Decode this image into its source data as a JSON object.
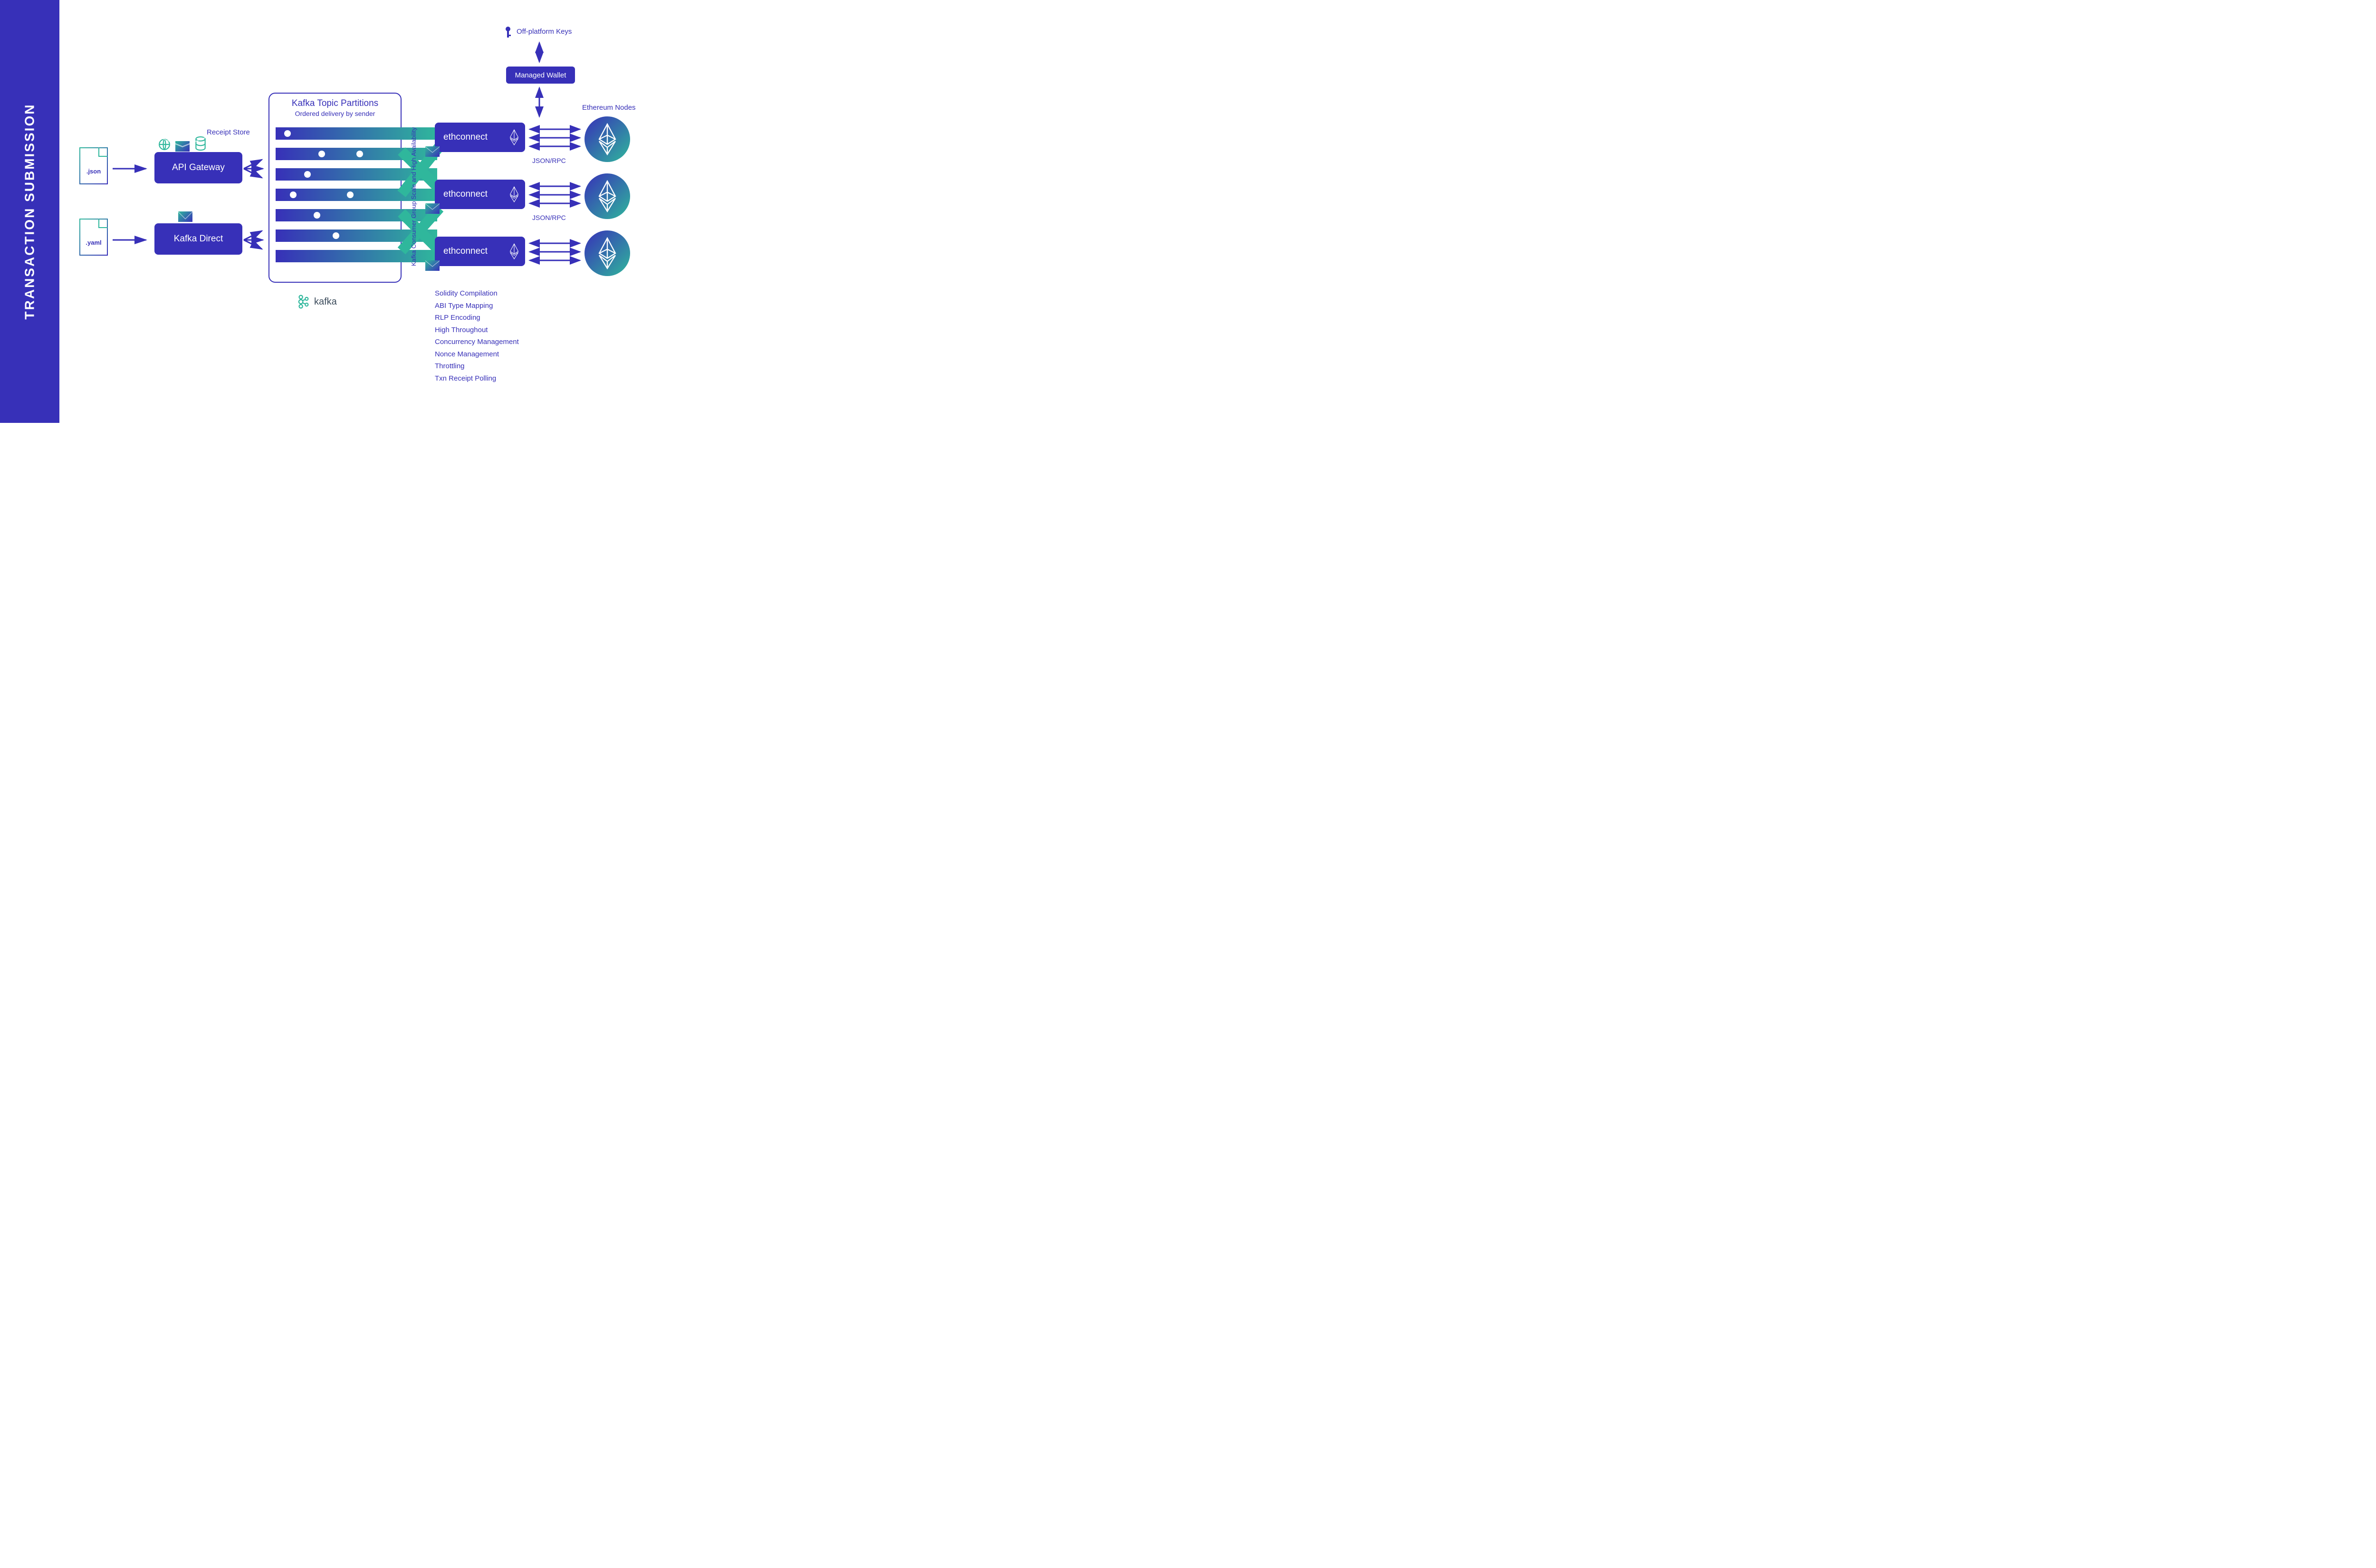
{
  "sidebar": {
    "title": "TRANSACTION  SUBMISSION"
  },
  "files": {
    "json": ".json",
    "yaml": ".yaml"
  },
  "boxes": {
    "api_gateway": "API Gateway",
    "kafka_direct": "Kafka Direct",
    "receipt_store_label": "Receipt Store"
  },
  "kafka": {
    "title": "Kafka Topic Partitions",
    "subtitle": "Ordered delivery by sender",
    "consumer_label": "Kafka Consumer Group Scale and High Availability",
    "brand": "kafka"
  },
  "ethconnect": {
    "label": "ethconnect",
    "proto": "JSON/RPC",
    "features": [
      "Solidity Compilation",
      "ABI Type Mapping",
      "RLP Encoding",
      "High Throughout",
      "Concurrency Management",
      "Nonce Management",
      "Throttling",
      "Txn Receipt Polling"
    ]
  },
  "wallet": {
    "offplatform": "Off-platform Keys",
    "managed": "Managed Wallet"
  },
  "nodes": {
    "label": "Ethereum Nodes"
  }
}
